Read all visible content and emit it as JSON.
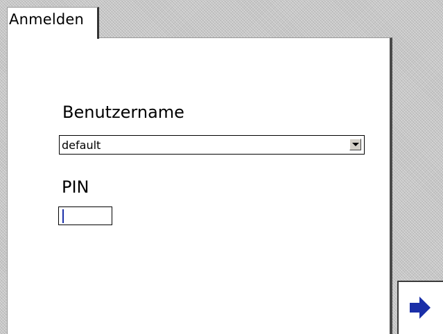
{
  "tab": {
    "label": "Anmelden"
  },
  "form": {
    "username_label": "Benutzername",
    "username_value": "default",
    "pin_label": "PIN",
    "pin_value": ""
  },
  "colors": {
    "accent": "#1a2fa8",
    "panel": "#ffffff",
    "background": "#c6c6c6"
  },
  "icons": {
    "next": "arrow-right-icon",
    "dropdown": "chevron-down-icon"
  }
}
